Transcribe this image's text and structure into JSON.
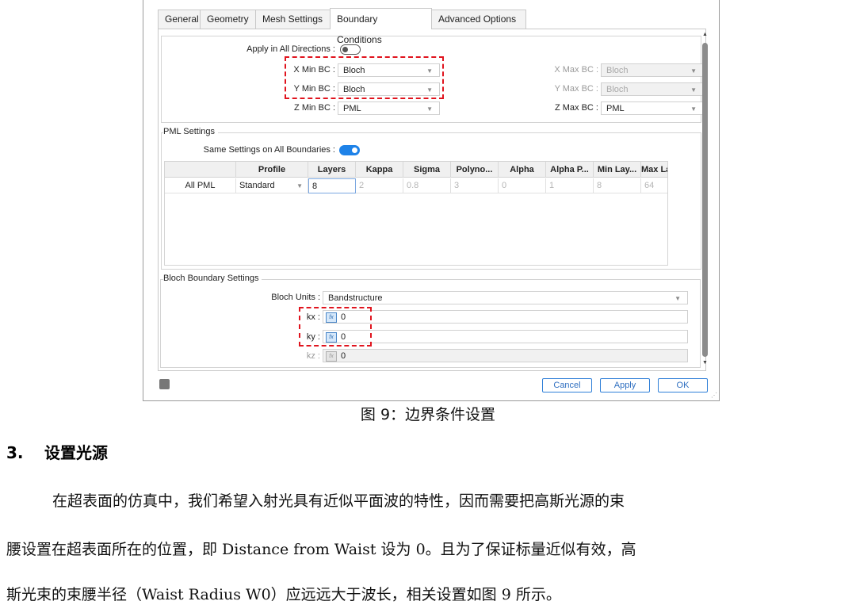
{
  "dialog": {
    "tabs": [
      "General",
      "Geometry",
      "Mesh Settings",
      "Boundary Conditions",
      "Advanced Options"
    ],
    "active_tab": "Boundary Conditions",
    "apply_all_label": "Apply in All Directions :",
    "apply_all_state": "off",
    "bc": {
      "xmin_label": "X Min BC :",
      "xmin_value": "Bloch",
      "ymin_label": "Y Min BC :",
      "ymin_value": "Bloch",
      "zmin_label": "Z Min BC :",
      "zmin_value": "PML",
      "xmax_label": "X Max BC :",
      "xmax_value": "Bloch",
      "ymax_label": "Y Max BC :",
      "ymax_value": "Bloch",
      "zmax_label": "Z Max BC :",
      "zmax_value": "PML"
    },
    "pml": {
      "title": "PML Settings",
      "same_label": "Same Settings on All Boundaries :",
      "same_state": "on",
      "headers": [
        "",
        "Profile",
        "Layers",
        "Kappa",
        "Sigma",
        "Polyno...",
        "Alpha",
        "Alpha P...",
        "Min Lay...",
        "Max Lay..."
      ],
      "row": [
        "All PML",
        "Standard",
        "8",
        "2",
        "0.8",
        "3",
        "0",
        "1",
        "8",
        "64"
      ]
    },
    "bloch": {
      "title": "Bloch Boundary Settings",
      "units_label": "Bloch Units :",
      "units_value": "Bandstructure",
      "kx_label": "kx :",
      "kx_value": "0",
      "ky_label": "ky :",
      "ky_value": "0",
      "kz_label": "kz :",
      "kz_value": "0"
    },
    "buttons": {
      "cancel": "Cancel",
      "apply": "Apply",
      "ok": "OK"
    },
    "accent": "#1e82e8",
    "highlight_color": "#e0141e"
  },
  "doc": {
    "caption": "图 9：边界条件设置",
    "section_number": "3.",
    "section_title": "设置光源",
    "para_line1": "在超表面的仿真中，我们希望入射光具有近似平面波的特性，因而需要把高斯光源的束",
    "para_line2": "腰设置在超表面所在的位置，即 Distance from Waist 设为 0。且为了保证标量近似有效，高",
    "para_line3": "斯光束的束腰半径（Waist Radius W0）应远远大于波长，相关设置如图 9 所示。"
  }
}
